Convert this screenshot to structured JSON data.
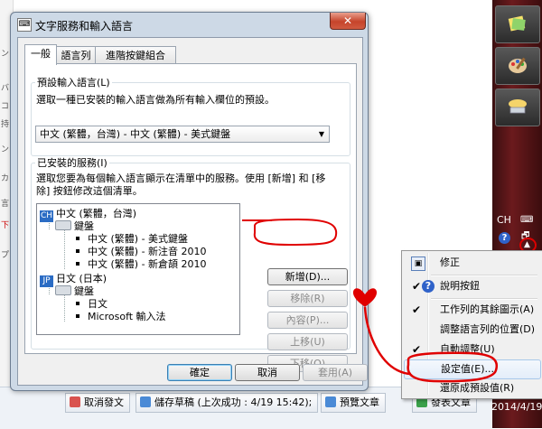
{
  "background": {
    "left_chars": [
      "ン",
      "バ",
      "コ",
      "持",
      "ン",
      "カ",
      "言",
      "下",
      "プ"
    ],
    "bottom_buttons": [
      {
        "label": "取消發文",
        "color": "#d9534f"
      },
      {
        "label": "儲存草稿 (上次成功 : 4/19 15:42);",
        "color": "#4a8ad6"
      },
      {
        "label": "預覽文章",
        "color": "#4a8ad6"
      },
      {
        "label": "發表文章",
        "color": "#3aa04a"
      }
    ]
  },
  "taskbar": {
    "lang": "CH",
    "kbd": "⌨",
    "help": "?",
    "min": "🗗",
    "chevron": "▲",
    "date": "2014/4/19"
  },
  "dialog": {
    "title": "文字服務和輸入語言",
    "close": "✕",
    "tabs": [
      {
        "label": "一般",
        "active": true
      },
      {
        "label": "語言列",
        "active": false
      },
      {
        "label": "進階按鍵組合",
        "active": false
      }
    ],
    "default_lang": {
      "legend": "預設輸入語言(L)",
      "desc": "選取一種已安裝的輸入語言做為所有輸入欄位的預設。",
      "selected": "中文 (繁體，台灣) - 中文 (繁體) - 美式鍵盤"
    },
    "installed": {
      "legend": "已安裝的服務(I)",
      "desc_line1": "選取您要為每個輸入語言顯示在清單中的服務。使用 [新增] 和 [移",
      "desc_line2": "除] 按鈕修改這個清單。",
      "tree": [
        {
          "kind": "lang",
          "badge": "CH",
          "label": "中文 (繁體，台灣)"
        },
        {
          "kind": "group",
          "label": "鍵盤"
        },
        {
          "kind": "item",
          "label": "中文 (繁體) - 美式鍵盤"
        },
        {
          "kind": "item",
          "label": "中文 (繁體) - 新注音 2010"
        },
        {
          "kind": "item",
          "label": "中文 (繁體) - 新倉頡 2010"
        },
        {
          "kind": "lang",
          "badge": "JP",
          "label": "日文 (日本)"
        },
        {
          "kind": "group",
          "label": "鍵盤"
        },
        {
          "kind": "item",
          "label": "日文"
        },
        {
          "kind": "item",
          "label": "Microsoft 輸入法"
        }
      ],
      "buttons": {
        "add": "新增(D)...",
        "remove": "移除(R)",
        "properties": "內容(P)...",
        "move_up": "上移(U)",
        "move_down": "下移(O)"
      }
    },
    "footer": {
      "ok": "確定",
      "cancel": "取消",
      "apply": "套用(A)"
    }
  },
  "context_menu": {
    "items": [
      {
        "label": "修正",
        "icon": "restore-icon"
      },
      {
        "label": "說明按鈕",
        "icon": "help-icon"
      },
      {
        "label": "工作列的其餘圖示(A)",
        "check": true
      },
      {
        "label": "調整語言列的位置(D)"
      },
      {
        "label": "自動調整(U)",
        "check": true
      },
      {
        "label": "設定值(E)...",
        "highlighted": true
      },
      {
        "label": "還原成預設值(R)"
      }
    ]
  }
}
